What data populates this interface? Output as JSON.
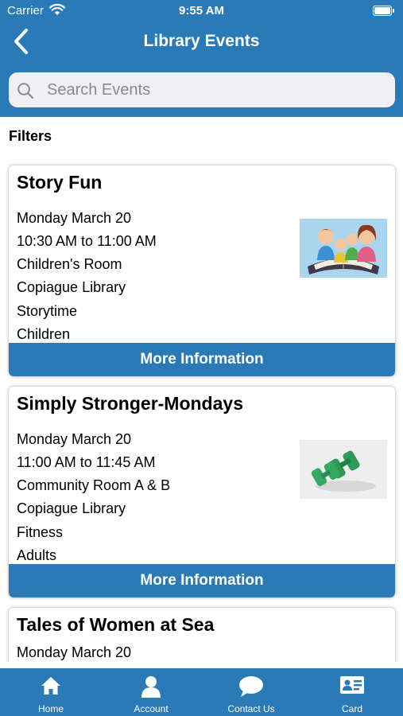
{
  "status_bar": {
    "carrier": "Carrier",
    "time": "9:55 AM"
  },
  "nav": {
    "title": "Library Events"
  },
  "search": {
    "placeholder": "Search Events"
  },
  "filters_label": "Filters",
  "events": [
    {
      "title": "Story Fun",
      "date": "Monday March 20",
      "time": "10:30 AM to 11:00 AM",
      "room": "Children's Room",
      "location": "Copiague Library",
      "category": "Storytime",
      "audience": "Children",
      "image": "family-reading-illustration",
      "button": "More Information"
    },
    {
      "title": "Simply Stronger-Mondays",
      "date": "Monday March 20",
      "time": "11:00 AM to 11:45 AM",
      "room": "Community Room A & B",
      "location": "Copiague Library",
      "category": "Fitness",
      "audience": "Adults",
      "image": "green-dumbbells-photo",
      "button": "More Information"
    },
    {
      "title": "Tales of Women at Sea",
      "date": "Monday March 20"
    }
  ],
  "tabbar": [
    {
      "label": "Home",
      "icon": "home-icon"
    },
    {
      "label": "Account",
      "icon": "person-icon"
    },
    {
      "label": "Contact Us",
      "icon": "chat-bubble-icon"
    },
    {
      "label": "Card",
      "icon": "id-card-icon"
    }
  ],
  "colors": {
    "brand": "#2a7ab7",
    "search_bg": "#f0f0f2",
    "placeholder": "#8a8a8e"
  }
}
